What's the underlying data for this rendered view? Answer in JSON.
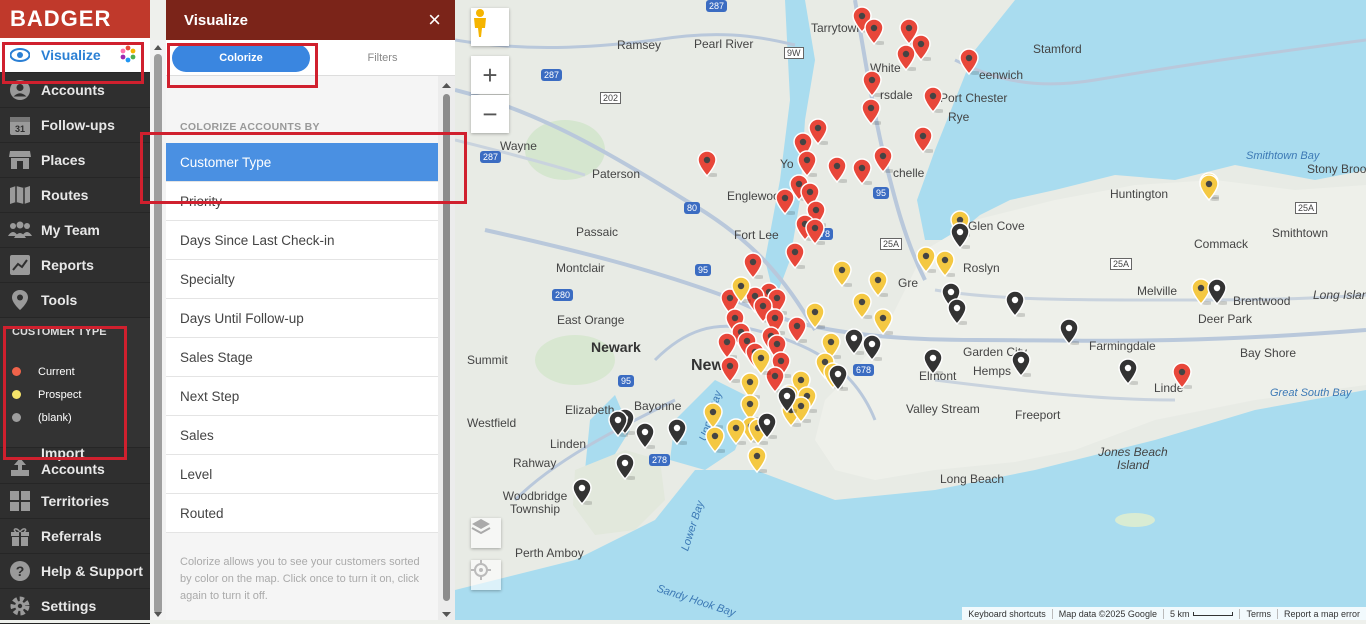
{
  "brand": "BADGER",
  "nav": {
    "items": [
      {
        "label": "Visualize",
        "icon": "eye-icon",
        "active": true
      },
      {
        "label": "Accounts",
        "icon": "user-icon"
      },
      {
        "label": "Follow-ups",
        "icon": "calendar-icon",
        "badge": "31"
      },
      {
        "label": "Places",
        "icon": "store-icon"
      },
      {
        "label": "Routes",
        "icon": "map-icon"
      },
      {
        "label": "My Team",
        "icon": "team-icon"
      },
      {
        "label": "Reports",
        "icon": "chart-icon"
      },
      {
        "label": "Tools",
        "icon": "pin-icon"
      }
    ],
    "items_bottom": [
      {
        "label": "Import Accounts",
        "icon": "upload-icon"
      },
      {
        "label": "Territories",
        "icon": "grid-icon"
      },
      {
        "label": "Referrals",
        "icon": "gift-icon"
      },
      {
        "label": "Help & Support",
        "icon": "help-icon"
      },
      {
        "label": "Settings",
        "icon": "gear-icon"
      }
    ]
  },
  "legend": {
    "title": "CUSTOMER TYPE",
    "items": [
      {
        "label": "Current",
        "color": "#f0634a"
      },
      {
        "label": "Prospect",
        "color": "#f5e36a"
      },
      {
        "label": "(blank)",
        "color": "#9e9e9e"
      }
    ]
  },
  "panel": {
    "title": "Visualize",
    "close": "×",
    "tabs": [
      "Colorize",
      "Filters"
    ],
    "section": "COLORIZE ACCOUNTS BY",
    "options": [
      "Customer Type",
      "Priority",
      "Days Since Last Check-in",
      "Specialty",
      "Days Until Follow-up",
      "Sales Stage",
      "Next Step",
      "Sales",
      "Level",
      "Routed"
    ],
    "selected": "Customer Type",
    "help": "Colorize allows you to see your customers sorted by color on the map. Click once to turn it on, click again to turn it off."
  },
  "map": {
    "controls": {
      "zoom_in": "+",
      "zoom_out": "−"
    },
    "labels": {
      "tarrytown": "Tarrytown",
      "ramsey": "Ramsey",
      "pearl_river": "Pearl River",
      "stamford": "Stamford",
      "white_plains": "White",
      "greenwich": "eenwich",
      "port_chester": "Port Chester",
      "rsdale": "rsdale",
      "rye": "Rye",
      "wayne": "Wayne",
      "paterson": "Paterson",
      "yonkers": "Yo",
      "chelle": "chelle",
      "smithtown_bay": "Smithtown Bay",
      "stony_brook": "Stony Brook",
      "englewood": "Englewood",
      "huntington": "Huntington",
      "fort_lee": "Fort Lee",
      "passaic": "Passaic",
      "glen_cove": "Glen Cove",
      "smithtown": "Smithtown",
      "commack": "Commack",
      "montclair": "Montclair",
      "roslyn": "Roslyn",
      "great_neck": "Gre",
      "melville": "Melville",
      "brentwood": "Brentwood",
      "east_orange": "East Orange",
      "deer_park": "Deer Park",
      "long_island": "Long Island",
      "newark": "Newark",
      "new_york": "New",
      "garden_city": "Garden City",
      "farmingdale": "Farmingdale",
      "summit": "Summit",
      "hempstead": "Hemps",
      "bay_shore": "Bay Shore",
      "elmont": "Elmont",
      "lindenhurst": "Linde",
      "elizabeth": "Elizabeth",
      "bayonne": "Bayonne",
      "valley_stream": "Valley Stream",
      "freeport": "Freeport",
      "westfield": "Westfield",
      "great_south_bay": "Great South Bay",
      "linden": "Linden",
      "rahway": "Rahway",
      "jones_beach": "Jones Beach Island",
      "woodbridge": "Woodbridge Township",
      "long_beach": "Long Beach",
      "perth_amboy": "Perth Amboy",
      "lower_bay": "Lower Bay",
      "sandy_hook": "Sandy Hook Bay",
      "upper_bay": "Upper Bay",
      "r9w": "9W",
      "r287a": "287",
      "r287b": "287",
      "r287c": "287",
      "r202": "202",
      "r80": "80",
      "r95a": "95",
      "r95b": "95",
      "r95c": "95",
      "r278a": "278",
      "r278b": "278",
      "r280": "280",
      "r678": "678",
      "r25a1": "25A",
      "r25a2": "25A",
      "r25a3": "25A"
    },
    "attribution": [
      "Keyboard shortcuts",
      "Map data ©2025 Google",
      "5 km",
      "Terms",
      "Report a map error"
    ]
  },
  "colors": {
    "current": "#e8473a",
    "prospect": "#f4c842",
    "blank": "#333333",
    "nav_bg": "#2f2f2f",
    "brand_bg": "#c0392b",
    "panel_head": "#7b2419",
    "accent": "#4a90e2"
  }
}
